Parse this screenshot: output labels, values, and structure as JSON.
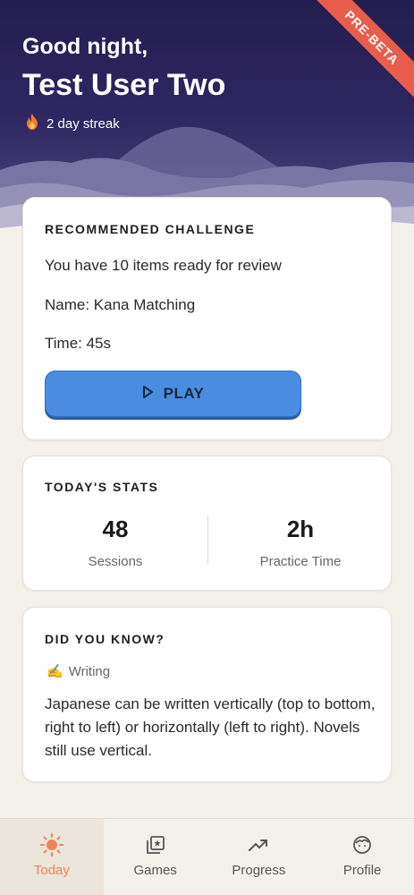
{
  "header": {
    "greeting": "Good night,",
    "user_name": "Test User Two",
    "streak_text": "2 day streak",
    "ribbon_label": "PRE-BETA",
    "icons": {
      "streak": "flame-icon"
    }
  },
  "recommended": {
    "title": "RECOMMENDED CHALLENGE",
    "review_text": "You have 10 items ready for review",
    "name_text": "Name: Kana Matching",
    "time_text": "Time: 45s",
    "play_label": "PLAY",
    "icons": {
      "play": "play-icon"
    }
  },
  "stats": {
    "title": "TODAY'S STATS",
    "items": [
      {
        "value": "48",
        "label": "Sessions"
      },
      {
        "value": "2h",
        "label": "Practice Time"
      }
    ]
  },
  "did_you_know": {
    "title": "DID YOU KNOW?",
    "category": "Writing",
    "category_icon": "✍️",
    "body": "Japanese can be written vertically (top to bottom, right to left) or horizontally (left to right). Novels still use vertical."
  },
  "nav": {
    "items": [
      {
        "label": "Today",
        "icon": "sun-icon",
        "active": true
      },
      {
        "label": "Games",
        "icon": "games-icon",
        "active": false
      },
      {
        "label": "Progress",
        "icon": "trend-icon",
        "active": false
      },
      {
        "label": "Profile",
        "icon": "face-icon",
        "active": false
      }
    ]
  },
  "colors": {
    "accent": "#f0845c",
    "play_button": "#4a8de0",
    "ribbon": "#e85d4a",
    "hero_top": "#241d4f"
  }
}
